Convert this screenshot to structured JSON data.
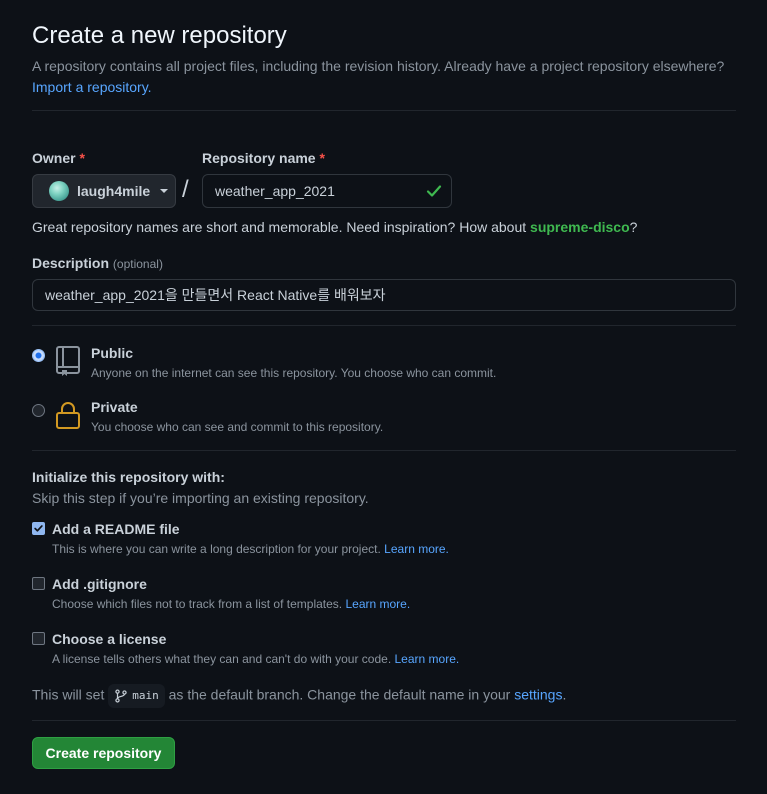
{
  "header": {
    "title": "Create a new repository",
    "subtitle": "A repository contains all project files, including the revision history. Already have a project repository elsewhere?",
    "import_link": "Import a repository."
  },
  "owner": {
    "label": "Owner",
    "required_mark": "*",
    "value": "laugh4mile"
  },
  "separator": "/",
  "repo_name": {
    "label": "Repository name",
    "required_mark": "*",
    "value": "weather_app_2021"
  },
  "name_hint": {
    "prefix": "Great repository names are short and memorable. Need inspiration? How about ",
    "suggestion": "supreme-disco",
    "suffix": "?"
  },
  "description": {
    "label": "Description",
    "optional": "(optional)",
    "value": "weather_app_2021을 만들면서 React Native를 배워보자"
  },
  "visibility": {
    "public": {
      "title": "Public",
      "desc": "Anyone on the internet can see this repository. You choose who can commit.",
      "selected": true
    },
    "private": {
      "title": "Private",
      "desc": "You choose who can see and commit to this repository.",
      "selected": false
    }
  },
  "init": {
    "title": "Initialize this repository with:",
    "subtitle": "Skip this step if you’re importing an existing repository.",
    "options": [
      {
        "title": "Add a README file",
        "desc": "This is where you can write a long description for your project.",
        "link": "Learn more.",
        "checked": true
      },
      {
        "title": "Add .gitignore",
        "desc": "Choose which files not to track from a list of templates.",
        "link": "Learn more.",
        "checked": false
      },
      {
        "title": "Choose a license",
        "desc": "A license tells others what they can and can't do with your code.",
        "link": "Learn more.",
        "checked": false
      }
    ]
  },
  "branch": {
    "prefix": "This will set",
    "name": "main",
    "middle": "as the default branch. Change the default name in your",
    "link": "settings",
    "suffix": "."
  },
  "submit": {
    "label": "Create repository"
  },
  "colors": {
    "background": "#0d1117",
    "link": "#58a6ff",
    "success": "#3fb950",
    "primary_button": "#238636",
    "required": "#f85149",
    "lock": "#d29922"
  }
}
